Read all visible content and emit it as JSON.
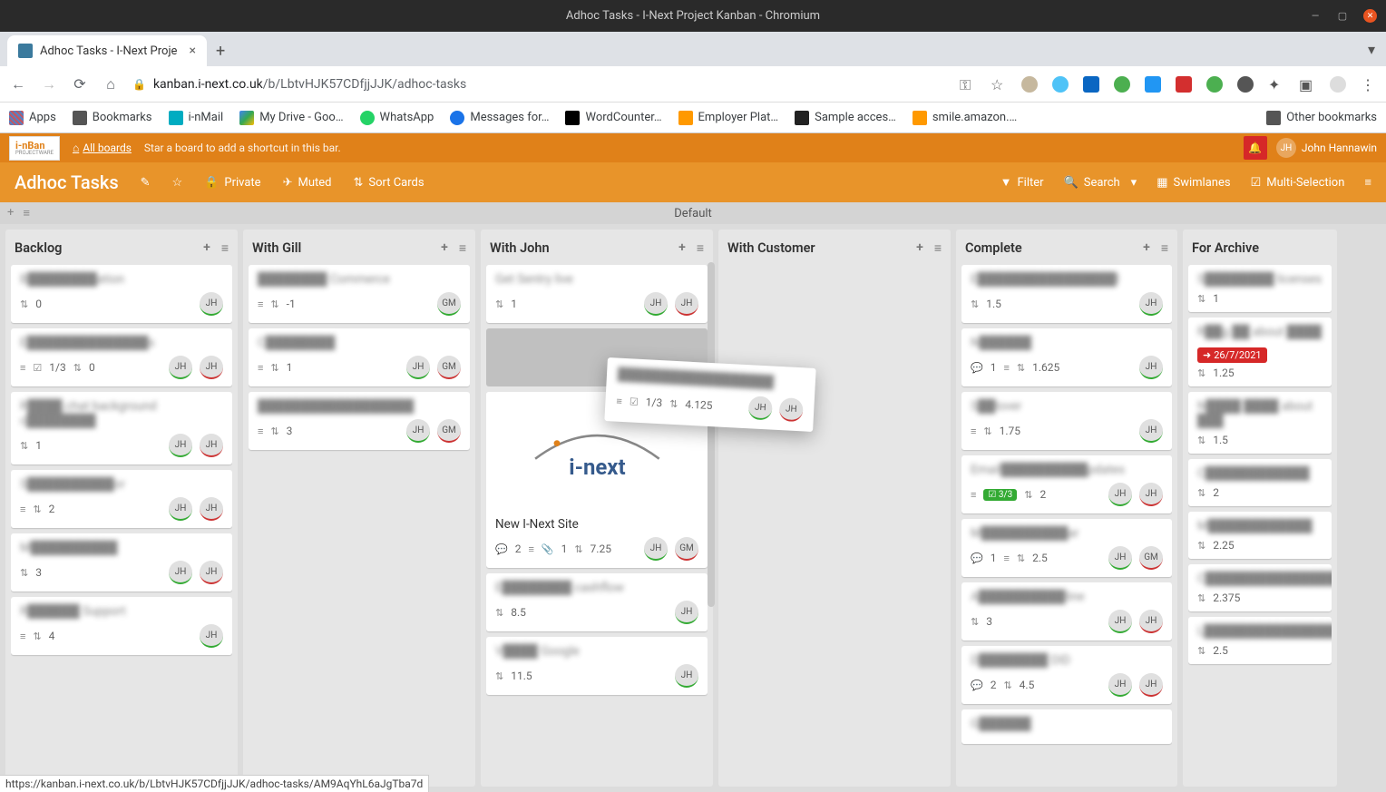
{
  "window_title": "Adhoc Tasks - I-Next Project Kanban - Chromium",
  "tab_title": "Adhoc Tasks - I-Next Proje",
  "url_domain": "kanban.i-next.co.uk",
  "url_path": "/b/LbtvHJK57CDfjjJJK/adhoc-tasks",
  "bookmarks": [
    "Apps",
    "Bookmarks",
    "i-nMail",
    "My Drive - Goo…",
    "WhatsApp",
    "Messages for…",
    "WordCounter…",
    "Employer Plat…",
    "Sample acces…",
    "smile.amazon.…"
  ],
  "other_bookmarks": "Other bookmarks",
  "logo_top": "i-nBan",
  "logo_sub": "PROJECTWARE",
  "all_boards": "All boards",
  "star_hint": "Star a board to add a shortcut in this bar.",
  "user_name": "John Hannawin",
  "user_initials": "JH",
  "board_title": "Adhoc Tasks",
  "btn_private": "Private",
  "btn_muted": "Muted",
  "btn_sort": "Sort Cards",
  "btn_filter": "Filter",
  "btn_search": "Search",
  "btn_swimlanes": "Swimlanes",
  "btn_multi": "Multi-Selection",
  "swimlane_default": "Default",
  "lists": {
    "backlog": "Backlog",
    "with_gill": "With Gill",
    "with_john": "With John",
    "with_customer": "With Customer",
    "complete": "Complete",
    "for_archive": "For Archive"
  },
  "cards": {
    "bl1_v": "0",
    "bl2_v": "1/3",
    "bl2_v2": "0",
    "bl3_v": "1",
    "bl4_v": "2",
    "bl5_v": "3",
    "bl6_v": "4",
    "wg1_v": "-1",
    "wg2_v": "1",
    "wg3_v": "3",
    "wj1_v": "1",
    "wj_site_title": "New I-Next Site",
    "wj_site_c": "2",
    "wj_site_a": "1",
    "wj_site_v": "7.25",
    "wj_drag_check": "1/3",
    "wj_drag_v": "4.125",
    "wj3_v": "8.5",
    "wj4_v": "11.5",
    "c1_v": "1.5",
    "c2_c": "1",
    "c2_v": "1.625",
    "c3_v": "1.75",
    "c4_chk": "3/3",
    "c4_v": "2",
    "c5_c": "1",
    "c5_v": "2.5",
    "c6_v": "3",
    "c7_c": "2",
    "c7_v": "4.5",
    "fa1_v": "1",
    "fa2_date": "26/7/2021",
    "fa2_v": "1.25",
    "fa3_v": "1.5",
    "fa4_v": "2",
    "fa5_v": "2.25",
    "fa6_v": "2.375",
    "fa7_v": "2.5"
  },
  "avatars": {
    "jh": "JH",
    "gm": "GM"
  },
  "status_url": "https://kanban.i-next.co.uk/b/LbtvHJK57CDfjjJJK/adhoc-tasks/AM9AqYhL6aJgTba7d"
}
